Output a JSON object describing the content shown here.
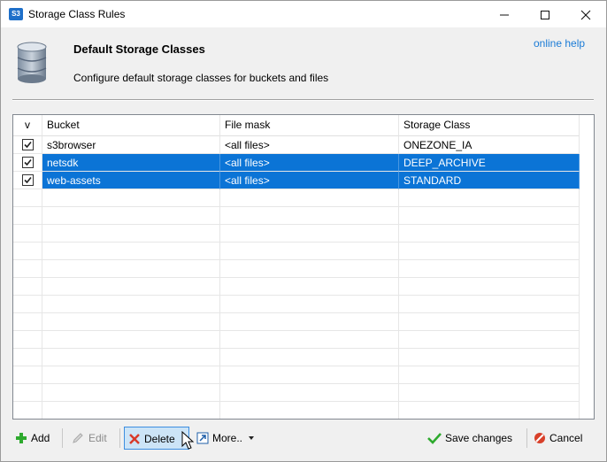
{
  "window": {
    "app_icon_text": "S3",
    "title": "Storage Class Rules"
  },
  "header": {
    "icon": "database-icon",
    "heading": "Default Storage Classes",
    "description": "Configure default storage classes for buckets and files",
    "help_link": "online help"
  },
  "table": {
    "columns": [
      "v",
      "Bucket",
      "File mask",
      "Storage Class"
    ],
    "rows": [
      {
        "checked": true,
        "bucket": "s3browser",
        "file_mask": "<all files>",
        "storage_class": "ONEZONE_IA",
        "selected": false
      },
      {
        "checked": true,
        "bucket": "netsdk",
        "file_mask": "<all files>",
        "storage_class": "DEEP_ARCHIVE",
        "selected": true
      },
      {
        "checked": true,
        "bucket": "web-assets",
        "file_mask": "<all files>",
        "storage_class": "STANDARD",
        "selected": true
      }
    ]
  },
  "toolbar": {
    "add_label": "Add",
    "edit_label": "Edit",
    "delete_label": "Delete",
    "more_label": "More..",
    "save_label": "Save changes",
    "cancel_label": "Cancel"
  },
  "colors": {
    "selection": "#0b74d6",
    "link": "#1a7bd6",
    "add_icon": "#2eaa2e",
    "delete_icon": "#d83a2a",
    "save_icon": "#2eaa2e",
    "cancel_icon": "#d8402a"
  }
}
